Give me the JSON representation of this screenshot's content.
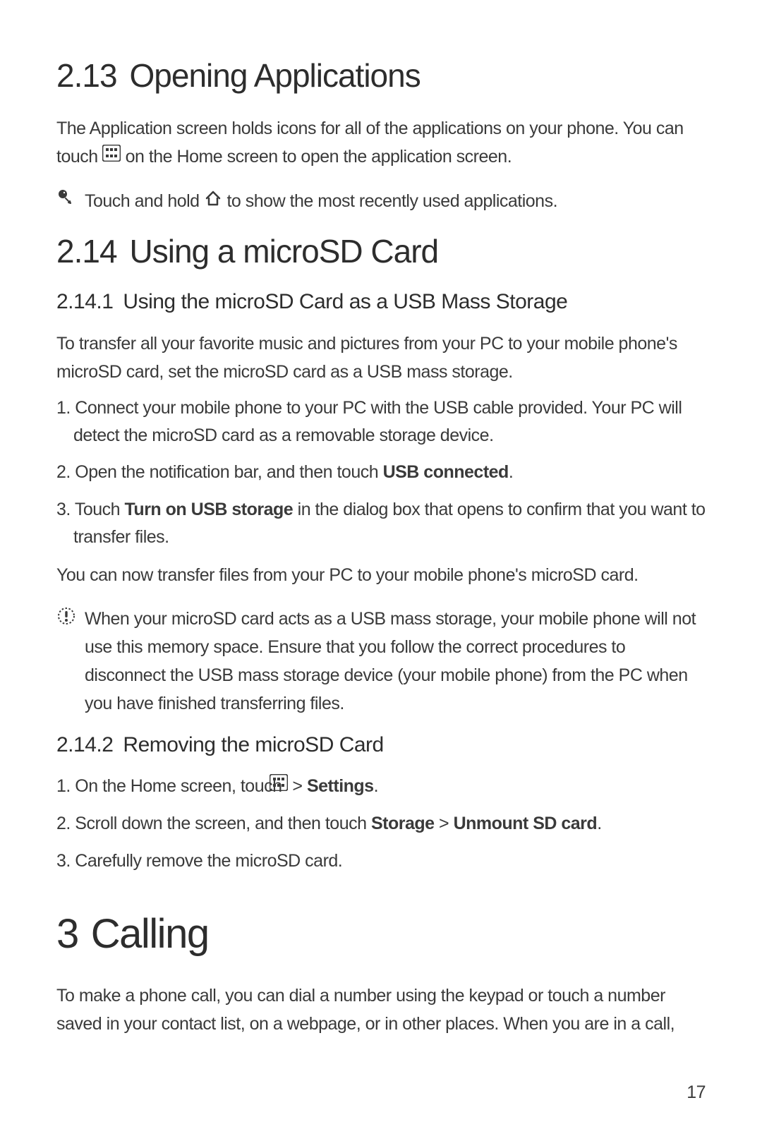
{
  "page_number": "17",
  "sec213": {
    "num": "2.13",
    "title": "Opening Applications",
    "p1a": "The Application screen holds icons for all of the applications on your phone. You can touch ",
    "p1b": " on the Home screen to open the application screen.",
    "tip_a": "Touch and hold ",
    "tip_b": " to show the most recently used applications."
  },
  "sec214": {
    "num": "2.14",
    "title": "Using a microSD Card",
    "sub1": {
      "num": "2.14.1",
      "title": "Using the microSD Card as a USB Mass Storage",
      "intro": "To transfer all your favorite music and pictures from your PC to your mobile phone's microSD card, set the microSD card as a USB mass storage.",
      "li1": "1. Connect your mobile phone to your PC with the USB cable provided. Your PC will detect the microSD card as a removable storage device.",
      "li2a": "2. Open the notification bar, and then touch ",
      "li2b": "USB connected",
      "li2c": ".",
      "li3a": "3. Touch ",
      "li3b": "Turn on USB storage",
      "li3c": " in the dialog box that opens to confirm that you want to transfer files.",
      "after": "You can now transfer files from your PC to your mobile phone's microSD card.",
      "warn": "When your microSD card acts as a USB mass storage, your mobile phone will not use this memory space. Ensure that you follow the correct procedures to disconnect the USB mass storage device (your mobile phone) from the PC when you have finished transferring files."
    },
    "sub2": {
      "num": "2.14.2",
      "title": "Removing the microSD Card",
      "li1a": "1. On the Home screen, touch ",
      "li1b": " > ",
      "li1c": "Settings",
      "li1d": ".",
      "li2a": "2. Scroll down the screen, and then touch ",
      "li2b": "Storage",
      "li2c": " > ",
      "li2d": "Unmount SD card",
      "li2e": ".",
      "li3": "3. Carefully remove the microSD card."
    }
  },
  "chap3": {
    "num": "3",
    "title": "Calling",
    "intro": "To make a phone call, you can dial a number using the keypad or touch a number saved in your contact list, on a webpage, or in other places. When you are in a call,"
  }
}
